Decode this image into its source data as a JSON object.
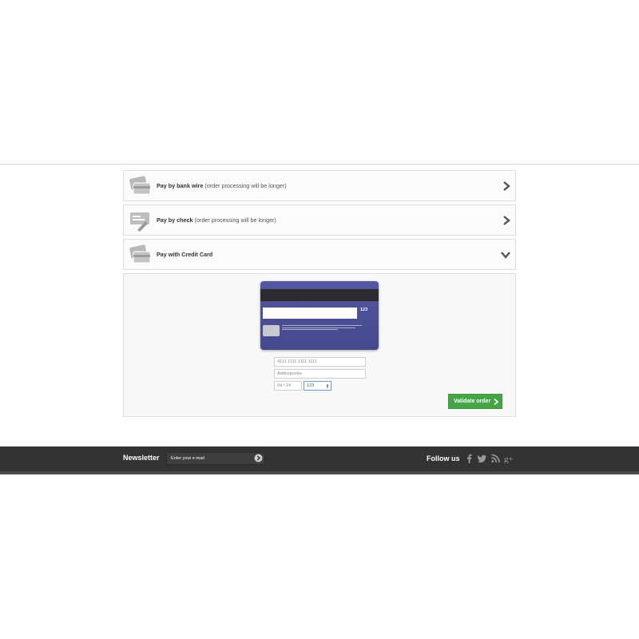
{
  "payment_methods": [
    {
      "name": "Pay by bank wire",
      "note": "(order processing will be longer)",
      "state": "collapsed",
      "icon": "bank-card-icon"
    },
    {
      "name": "Pay by check",
      "note": "(order processing will be longer)",
      "state": "collapsed",
      "icon": "check-icon"
    },
    {
      "name": "Pay with Credit Card",
      "note": "",
      "state": "expanded",
      "icon": "credit-card-icon"
    }
  ],
  "card_preview": {
    "cvv_text": "123"
  },
  "card_form": {
    "number_placeholder": "4111 1111 1111 1111",
    "name_placeholder": "Addosiposta",
    "expiry_placeholder": "04 / 24",
    "cvc_value": "123"
  },
  "actions": {
    "validate_label": "Validate order"
  },
  "footer": {
    "newsletter_title": "Newsletter",
    "newsletter_placeholder": "Enter your e-mail",
    "follow_title": "Follow us",
    "social_icons": [
      "facebook-icon",
      "twitter-icon",
      "rss-icon",
      "google-plus-icon"
    ]
  },
  "colors": {
    "accent_green": "#43a546",
    "card_blue": "#4b4e94",
    "footer_bg": "#333333"
  }
}
